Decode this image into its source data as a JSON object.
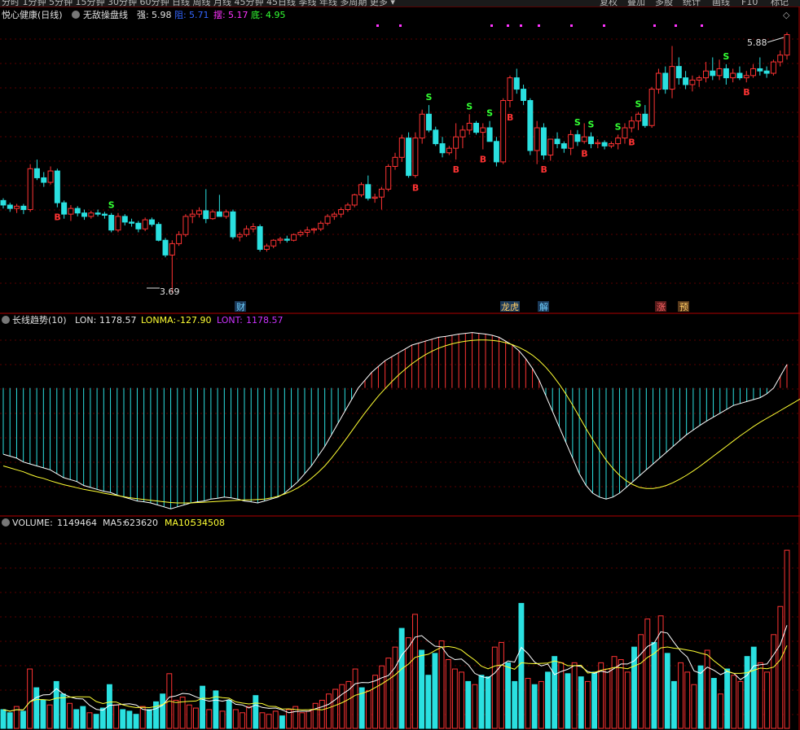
{
  "colors": {
    "up": "#ff3333",
    "down": "#2ae0e0",
    "ma_white": "#ffffff",
    "ma_yellow": "#ffff33",
    "purple": "#cc33ff",
    "grid": "#5a0000",
    "divider": "#b00000",
    "green_text": "#33ff33",
    "blue_text": "#3366ff",
    "magenta_text": "#ff33ff"
  },
  "toolbar": {
    "left": "分时 1分钟 5分钟 15分钟 30分钟 60分钟 日线 周线 月线 45分钟 45日线 季线 年线 多周期 更多 ▾",
    "right_items": [
      "复权",
      "叠加",
      "多股",
      "统计",
      "画线",
      "F10",
      "标记"
    ]
  },
  "price_panel": {
    "title": "悦心健康(日线)",
    "indicator": "无敌操盘线",
    "strong_label": "强:",
    "strong_value": "5.98",
    "pressure_label": "阻:",
    "pressure_value": "5.71",
    "swing_label": "摆:",
    "swing_value": "5.17",
    "bottom_label": "底:",
    "bottom_value": "4.95",
    "high_marker": "5.88",
    "low_marker": "3.69"
  },
  "event_tags": [
    "财",
    "龙虎",
    "解",
    "涨",
    "预"
  ],
  "lon_panel": {
    "title": "长线趋势(10)",
    "lon_label": "LON:",
    "lon_value": "1178.57",
    "lonma_label": "LONMA:",
    "lonma_value": "-127.90",
    "lont_label": "LONT:",
    "lont_value": "1178.57"
  },
  "volume_panel": {
    "title": "VOLUME:",
    "value": "1149464",
    "ma5_label": "MA5:",
    "ma5_value": "623620",
    "ma10_label": "MA10:",
    "ma10_value": "534508"
  },
  "chart_data": {
    "type": "candlestick",
    "title": "悦心健康(日线)",
    "ohlc": [
      [
        4.5,
        4.52,
        4.43,
        4.46
      ],
      [
        4.46,
        4.48,
        4.4,
        4.43
      ],
      [
        4.43,
        4.47,
        4.39,
        4.45
      ],
      [
        4.45,
        4.47,
        4.38,
        4.42
      ],
      [
        4.42,
        4.82,
        4.4,
        4.78
      ],
      [
        4.78,
        4.86,
        4.68,
        4.7
      ],
      [
        4.7,
        4.75,
        4.62,
        4.66
      ],
      [
        4.66,
        4.8,
        4.64,
        4.76
      ],
      [
        4.76,
        4.78,
        4.44,
        4.48
      ],
      [
        4.48,
        4.5,
        4.34,
        4.38
      ],
      [
        4.38,
        4.46,
        4.32,
        4.43
      ],
      [
        4.43,
        4.45,
        4.36,
        4.39
      ],
      [
        4.39,
        4.42,
        4.33,
        4.36
      ],
      [
        4.36,
        4.41,
        4.34,
        4.39
      ],
      [
        4.39,
        4.42,
        4.36,
        4.38
      ],
      [
        4.38,
        4.4,
        4.34,
        4.37
      ],
      [
        4.37,
        4.39,
        4.22,
        4.24
      ],
      [
        4.24,
        4.39,
        4.22,
        4.36
      ],
      [
        4.36,
        4.38,
        4.28,
        4.31
      ],
      [
        4.31,
        4.34,
        4.27,
        4.3
      ],
      [
        4.3,
        4.32,
        4.22,
        4.25
      ],
      [
        4.25,
        4.35,
        4.23,
        4.33
      ],
      [
        4.33,
        4.35,
        4.27,
        4.29
      ],
      [
        4.29,
        4.31,
        4.14,
        4.15
      ],
      [
        4.15,
        4.17,
        4.0,
        4.02
      ],
      [
        4.02,
        4.15,
        3.69,
        4.12
      ],
      [
        4.12,
        4.23,
        4.1,
        4.2
      ],
      [
        4.2,
        4.38,
        4.18,
        4.36
      ],
      [
        4.36,
        4.42,
        4.3,
        4.38
      ],
      [
        4.38,
        4.44,
        4.35,
        4.41
      ],
      [
        4.41,
        4.6,
        4.3,
        4.34
      ],
      [
        4.34,
        4.42,
        4.33,
        4.4
      ],
      [
        4.4,
        4.55,
        4.38,
        4.36
      ],
      [
        4.36,
        4.42,
        4.34,
        4.4
      ],
      [
        4.4,
        4.42,
        4.16,
        4.18
      ],
      [
        4.18,
        4.22,
        4.14,
        4.2
      ],
      [
        4.2,
        4.28,
        4.18,
        4.25
      ],
      [
        4.25,
        4.3,
        4.22,
        4.27
      ],
      [
        4.27,
        4.29,
        4.05,
        4.07
      ],
      [
        4.07,
        4.12,
        4.05,
        4.1
      ],
      [
        4.1,
        4.16,
        4.08,
        4.15
      ],
      [
        4.15,
        4.18,
        4.12,
        4.16
      ],
      [
        4.16,
        4.19,
        4.13,
        4.15
      ],
      [
        4.15,
        4.21,
        4.14,
        4.2
      ],
      [
        4.2,
        4.24,
        4.18,
        4.22
      ],
      [
        4.22,
        4.27,
        4.18,
        4.24
      ],
      [
        4.24,
        4.26,
        4.21,
        4.25
      ],
      [
        4.25,
        4.32,
        4.23,
        4.3
      ],
      [
        4.3,
        4.38,
        4.28,
        4.36
      ],
      [
        4.36,
        4.4,
        4.33,
        4.38
      ],
      [
        4.38,
        4.44,
        4.35,
        4.42
      ],
      [
        4.42,
        4.48,
        4.4,
        4.46
      ],
      [
        4.46,
        4.56,
        4.44,
        4.55
      ],
      [
        4.55,
        4.66,
        4.53,
        4.64
      ],
      [
        4.64,
        4.72,
        4.5,
        4.52
      ],
      [
        4.52,
        4.56,
        4.48,
        4.53
      ],
      [
        4.53,
        4.62,
        4.42,
        4.6
      ],
      [
        4.6,
        4.82,
        4.58,
        4.8
      ],
      [
        4.8,
        4.92,
        4.77,
        4.88
      ],
      [
        4.88,
        5.08,
        4.84,
        5.05
      ],
      [
        5.05,
        5.1,
        4.7,
        4.72
      ],
      [
        4.72,
        5.1,
        4.7,
        5.05
      ],
      [
        5.05,
        5.3,
        5.0,
        5.26
      ],
      [
        5.26,
        5.34,
        5.1,
        5.12
      ],
      [
        5.12,
        5.15,
        4.98,
        5.0
      ],
      [
        5.0,
        5.06,
        4.88,
        4.92
      ],
      [
        4.92,
        4.98,
        4.9,
        4.96
      ],
      [
        4.96,
        5.18,
        4.86,
        5.06
      ],
      [
        5.06,
        5.16,
        4.96,
        5.12
      ],
      [
        5.12,
        5.26,
        5.08,
        5.18
      ],
      [
        5.18,
        5.2,
        5.08,
        5.1
      ],
      [
        5.1,
        5.18,
        4.95,
        5.14
      ],
      [
        5.14,
        5.2,
        5.05,
        5.02
      ],
      [
        5.02,
        5.06,
        4.8,
        4.84
      ],
      [
        4.84,
        5.4,
        4.82,
        5.38
      ],
      [
        5.38,
        5.6,
        5.32,
        5.58
      ],
      [
        5.58,
        5.66,
        5.44,
        5.48
      ],
      [
        5.48,
        5.52,
        5.34,
        5.38
      ],
      [
        5.38,
        5.4,
        4.9,
        4.94
      ],
      [
        4.94,
        5.2,
        4.82,
        5.14
      ],
      [
        5.14,
        5.18,
        4.86,
        4.9
      ],
      [
        4.9,
        5.0,
        4.85,
        5.04
      ],
      [
        5.04,
        5.1,
        4.96,
        5.0
      ],
      [
        5.0,
        5.02,
        4.92,
        4.96
      ],
      [
        4.96,
        5.12,
        4.9,
        5.08
      ],
      [
        5.08,
        5.12,
        4.98,
        5.02
      ],
      [
        5.02,
        5.18,
        5.0,
        5.06
      ],
      [
        5.06,
        5.1,
        4.96,
        5.0
      ],
      [
        5.0,
        5.04,
        4.96,
        5.01
      ],
      [
        5.01,
        5.03,
        4.95,
        4.98
      ],
      [
        4.98,
        5.02,
        4.96,
        5.0
      ],
      [
        5.0,
        5.08,
        4.95,
        5.05
      ],
      [
        5.05,
        5.18,
        5.0,
        5.14
      ],
      [
        5.14,
        5.24,
        5.1,
        5.2
      ],
      [
        5.2,
        5.28,
        5.12,
        5.26
      ],
      [
        5.26,
        5.34,
        5.14,
        5.16
      ],
      [
        5.16,
        5.5,
        5.14,
        5.48
      ],
      [
        5.48,
        5.66,
        5.44,
        5.62
      ],
      [
        5.62,
        5.68,
        5.44,
        5.48
      ],
      [
        5.48,
        5.86,
        5.4,
        5.68
      ],
      [
        5.68,
        5.76,
        5.52,
        5.58
      ],
      [
        5.58,
        5.64,
        5.48,
        5.52
      ],
      [
        5.52,
        5.6,
        5.46,
        5.56
      ],
      [
        5.56,
        5.6,
        5.5,
        5.58
      ],
      [
        5.58,
        5.72,
        5.54,
        5.64
      ],
      [
        5.64,
        5.76,
        5.56,
        5.6
      ],
      [
        5.6,
        5.74,
        5.56,
        5.66
      ],
      [
        5.66,
        5.7,
        5.52,
        5.58
      ],
      [
        5.58,
        5.66,
        5.54,
        5.62
      ],
      [
        5.62,
        5.68,
        5.56,
        5.58
      ],
      [
        5.58,
        5.64,
        5.54,
        5.6
      ],
      [
        5.6,
        5.7,
        5.58,
        5.66
      ],
      [
        5.66,
        5.76,
        5.6,
        5.64
      ],
      [
        5.64,
        5.68,
        5.58,
        5.62
      ],
      [
        5.62,
        5.74,
        5.6,
        5.72
      ],
      [
        5.72,
        5.82,
        5.68,
        5.78
      ],
      [
        5.78,
        5.98,
        5.74,
        5.96
      ]
    ],
    "signals": {
      "S": [
        16,
        63,
        69,
        72,
        85,
        87,
        91,
        94,
        107,
        125
      ],
      "B": [
        8,
        61,
        67,
        71,
        75,
        80,
        86,
        93,
        110,
        128
      ]
    },
    "lon": [
      -170,
      -175,
      -180,
      -190,
      -195,
      -200,
      -205,
      -210,
      -220,
      -230,
      -235,
      -240,
      -250,
      -255,
      -260,
      -265,
      -268,
      -275,
      -280,
      -285,
      -290,
      -292,
      -295,
      -300,
      -305,
      -310,
      -305,
      -300,
      -295,
      -292,
      -290,
      -285,
      -283,
      -280,
      -282,
      -285,
      -290,
      -292,
      -295,
      -290,
      -285,
      -280,
      -270,
      -255,
      -240,
      -220,
      -200,
      -175,
      -150,
      -120,
      -90,
      -60,
      -30,
      0,
      20,
      40,
      55,
      70,
      80,
      90,
      100,
      110,
      115,
      120,
      125,
      130,
      132,
      135,
      138,
      140,
      142,
      140,
      138,
      135,
      130,
      120,
      110,
      95,
      75,
      50,
      20,
      -20,
      -60,
      -100,
      -140,
      -180,
      -220,
      -250,
      -270,
      -280,
      -285,
      -280,
      -270,
      -255,
      -240,
      -225,
      -210,
      -195,
      -180,
      -165,
      -150,
      -135,
      -120,
      -108,
      -96,
      -85,
      -75,
      -65,
      -55,
      -45,
      -40,
      -35,
      -30,
      -25,
      -15,
      0,
      30,
      60
    ],
    "lonma": [
      -200,
      -205,
      -210,
      -215,
      -222,
      -228,
      -232,
      -238,
      -243,
      -248,
      -252,
      -256,
      -260,
      -263,
      -266,
      -270,
      -273,
      -276,
      -279,
      -282,
      -284,
      -286,
      -288,
      -290,
      -292,
      -294,
      -295,
      -295,
      -295,
      -294,
      -293,
      -292,
      -291,
      -290,
      -289,
      -288,
      -287,
      -287,
      -286,
      -285,
      -282,
      -278,
      -272,
      -265,
      -256,
      -245,
      -232,
      -217,
      -200,
      -180,
      -158,
      -135,
      -111,
      -87,
      -64,
      -42,
      -21,
      -2,
      16,
      33,
      48,
      62,
      74,
      85,
      94,
      102,
      108,
      113,
      117,
      120,
      122,
      123,
      123,
      122,
      120,
      116,
      111,
      104,
      95,
      84,
      70,
      53,
      33,
      10,
      -16,
      -44,
      -74,
      -104,
      -133,
      -160,
      -185,
      -206,
      -224,
      -238,
      -248,
      -255,
      -258,
      -258,
      -255,
      -250,
      -243,
      -234,
      -224,
      -213,
      -201,
      -188,
      -175,
      -162,
      -149,
      -136,
      -123,
      -111,
      -99,
      -88,
      -78,
      -68,
      -58,
      -48,
      -38,
      -28
    ],
    "volume": [
      12,
      10,
      14,
      11,
      38,
      26,
      18,
      15,
      30,
      22,
      16,
      12,
      14,
      10,
      9,
      13,
      28,
      15,
      12,
      11,
      9,
      14,
      12,
      17,
      22,
      35,
      18,
      20,
      15,
      13,
      27,
      12,
      24,
      11,
      18,
      12,
      10,
      14,
      21,
      10,
      9,
      11,
      8,
      12,
      14,
      10,
      11,
      16,
      18,
      22,
      25,
      28,
      30,
      38,
      26,
      24,
      34,
      40,
      45,
      52,
      64,
      58,
      73,
      50,
      34,
      48,
      56,
      44,
      38,
      36,
      30,
      28,
      34,
      33,
      52,
      55,
      42,
      30,
      80,
      32,
      28,
      30,
      36,
      46,
      42,
      35,
      42,
      33,
      30,
      36,
      42,
      38,
      46,
      44,
      36,
      52,
      60,
      70,
      55,
      72,
      48,
      30,
      42,
      36,
      28,
      40,
      50,
      32,
      22,
      38,
      34,
      30,
      46,
      52,
      42,
      36,
      60,
      78,
      114
    ]
  }
}
